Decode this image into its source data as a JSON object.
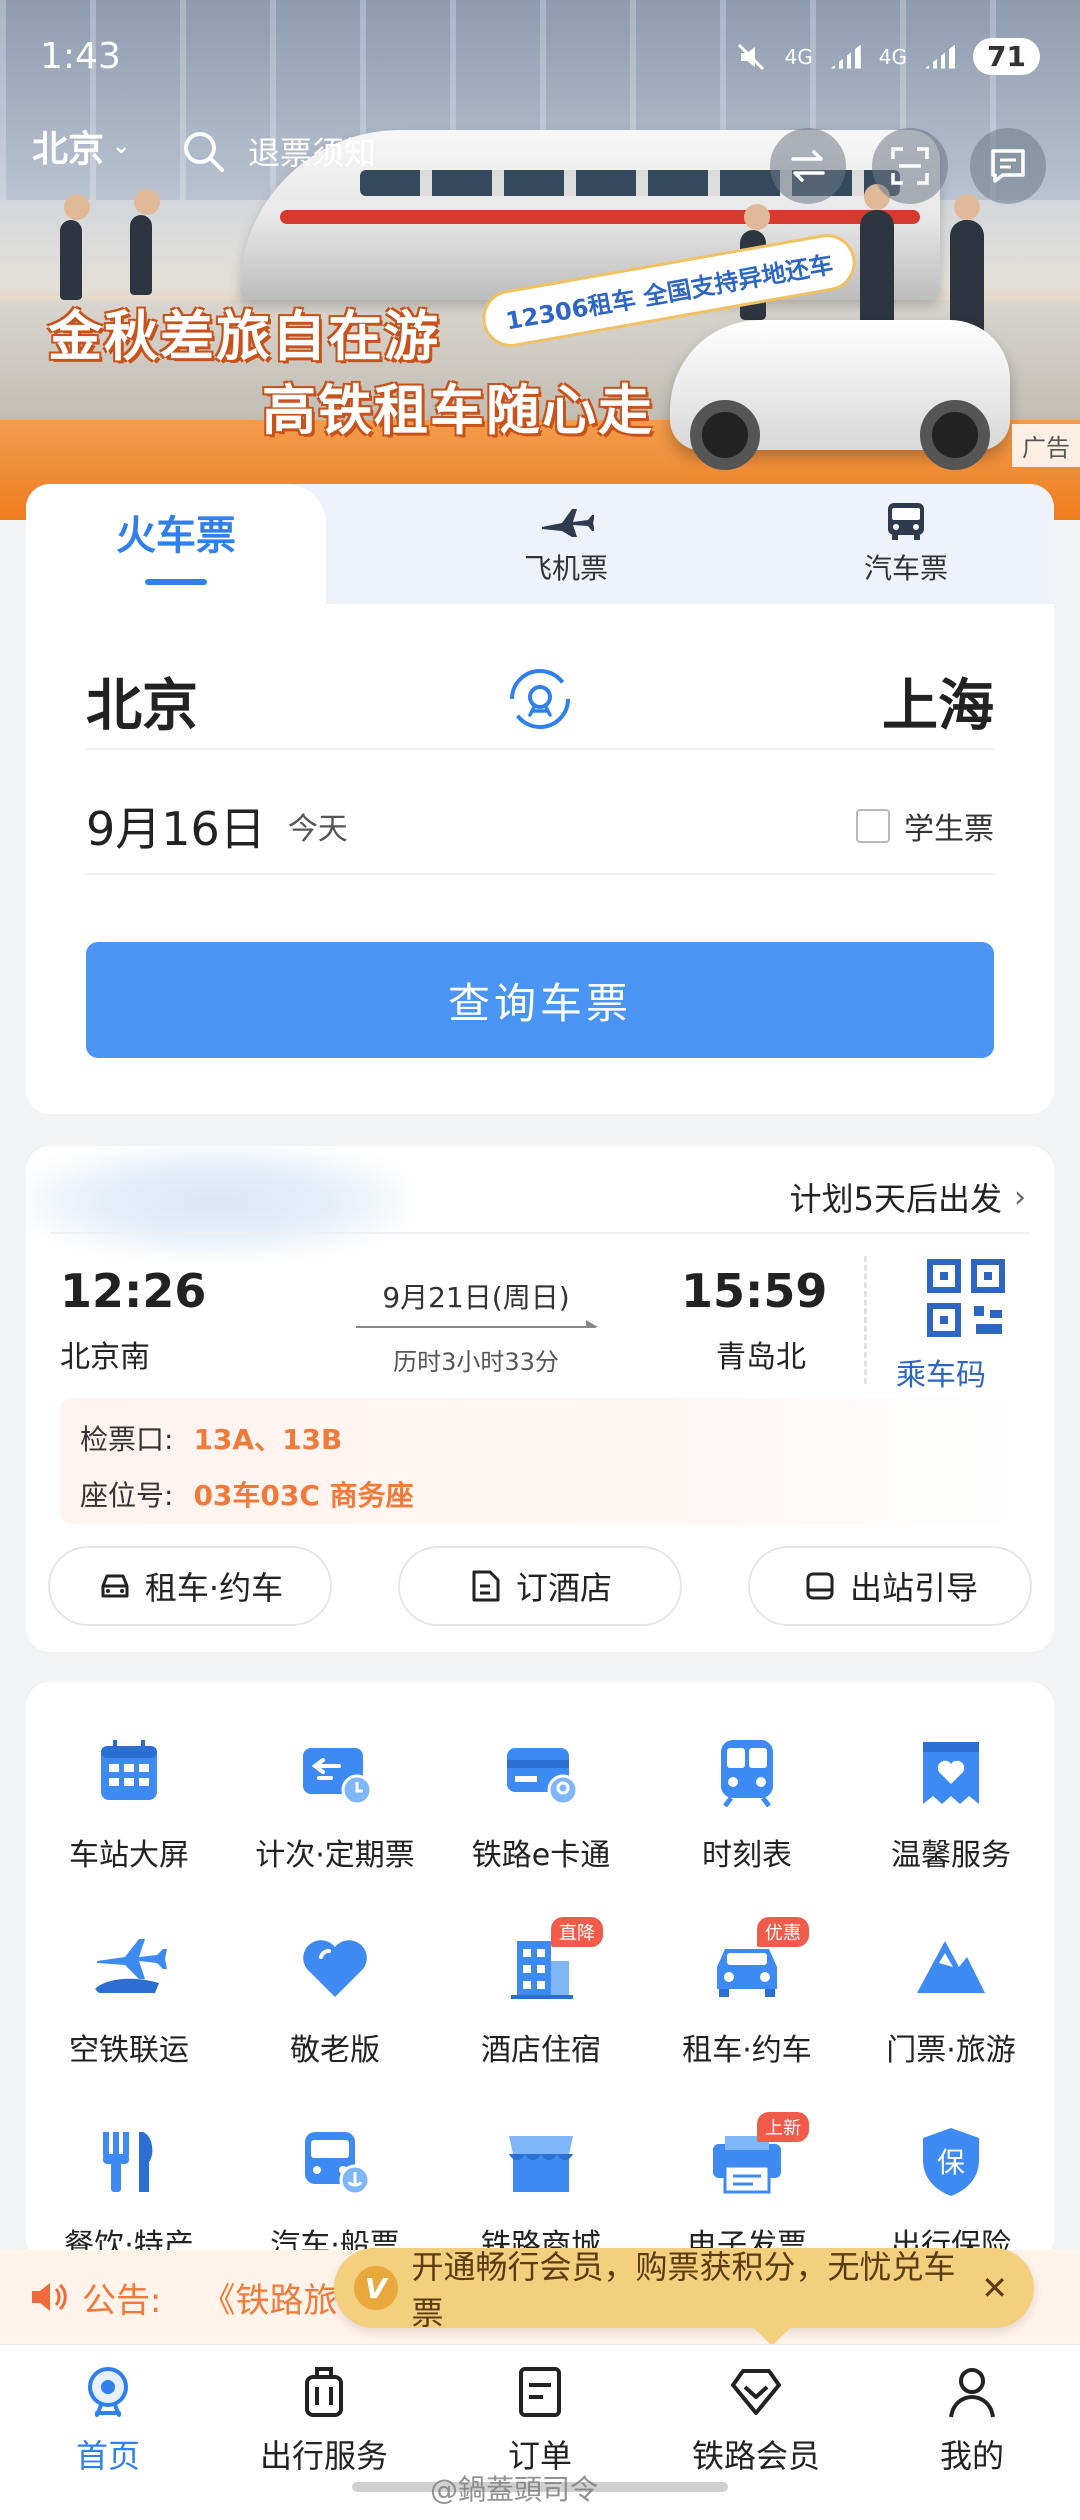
{
  "status": {
    "time": "1:43",
    "battery": "71",
    "net1": "4G",
    "net2": "4G"
  },
  "header": {
    "city": "北京",
    "search_placeholder": "退票须知"
  },
  "banner": {
    "line1": "金秋差旅自在游",
    "line2": "高铁租车随心走",
    "tag": "12306租车 全国支持异地还车",
    "ad_label": "广告"
  },
  "tabs": {
    "train": "火车票",
    "flight": "飞机票",
    "bus": "汽车票"
  },
  "search": {
    "from": "北京",
    "to": "上海",
    "date": "9月16日",
    "date_sub": "今天",
    "student": "学生票",
    "student_checked": false,
    "query_button": "查询车票"
  },
  "trip": {
    "plan": "计划5天后出发",
    "dep_time": "12:26",
    "dep_station": "北京南",
    "date": "9月21日(周日)",
    "duration": "历时3小时33分",
    "arr_time": "15:59",
    "arr_station": "青岛北",
    "qr_label": "乘车码",
    "gate_label": "检票口:",
    "gate": "13A、13B",
    "seat_label": "座位号:",
    "seat": "03车03C 商务座",
    "actions": [
      "租车·约车",
      "订酒店",
      "出站引导"
    ]
  },
  "services": [
    {
      "label": "车站大屏",
      "icon": "station-screen-icon"
    },
    {
      "label": "计次·定期票",
      "icon": "period-ticket-icon"
    },
    {
      "label": "铁路e卡通",
      "icon": "rail-ecard-icon"
    },
    {
      "label": "时刻表",
      "icon": "timetable-icon"
    },
    {
      "label": "温馨服务",
      "icon": "care-service-icon"
    },
    {
      "label": "空铁联运",
      "icon": "air-rail-icon"
    },
    {
      "label": "敬老版",
      "icon": "heart-icon"
    },
    {
      "label": "酒店住宿",
      "icon": "hotel-icon",
      "badge": "直降"
    },
    {
      "label": "租车·约车",
      "icon": "car-icon",
      "badge": "优惠"
    },
    {
      "label": "门票·旅游",
      "icon": "mountain-icon"
    },
    {
      "label": "餐饮·特产",
      "icon": "food-icon"
    },
    {
      "label": "汽车·船票",
      "icon": "bus-ship-icon"
    },
    {
      "label": "铁路商城",
      "icon": "shop-icon"
    },
    {
      "label": "电子发票",
      "icon": "invoice-icon",
      "badge": "上新"
    },
    {
      "label": "出行保险",
      "icon": "insurance-icon"
    }
  ],
  "notice": {
    "label": "公告:",
    "text": "《铁路旅"
  },
  "member_tip": {
    "badge": "V",
    "text": "开通畅行会员，购票获积分，无忧兑车票",
    "close": "✕"
  },
  "nav": [
    "首页",
    "出行服务",
    "订单",
    "铁路会员",
    "我的"
  ],
  "watermark": "@鍋蓋頭司令",
  "colors": {
    "accent": "#2f80ed",
    "button": "#4a95f4",
    "orange": "#f07a3a",
    "member": "#f3cf7e"
  }
}
